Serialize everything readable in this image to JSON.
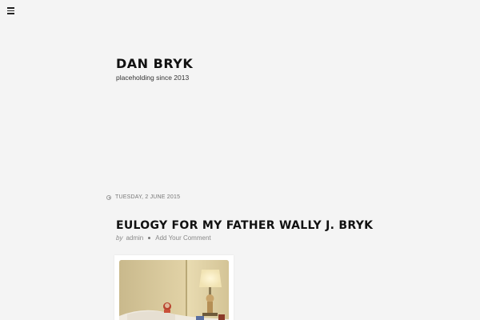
{
  "header": {
    "site_title": "DAN BRYK",
    "tagline": "placeholding since 2013"
  },
  "nav": {
    "menu_icon": "hamburger-menu-icon"
  },
  "post": {
    "date": "TUESDAY, 2 JUNE 2015",
    "date_icon": "clock-icon",
    "title": "EULOGY FOR MY FATHER WALLY J. BRYK",
    "byline_prefix": "by",
    "author": "admin",
    "comment_link": "Add Your Comment"
  },
  "colors": {
    "background": "#f4f4f4",
    "text": "#111111",
    "muted": "#888888"
  }
}
